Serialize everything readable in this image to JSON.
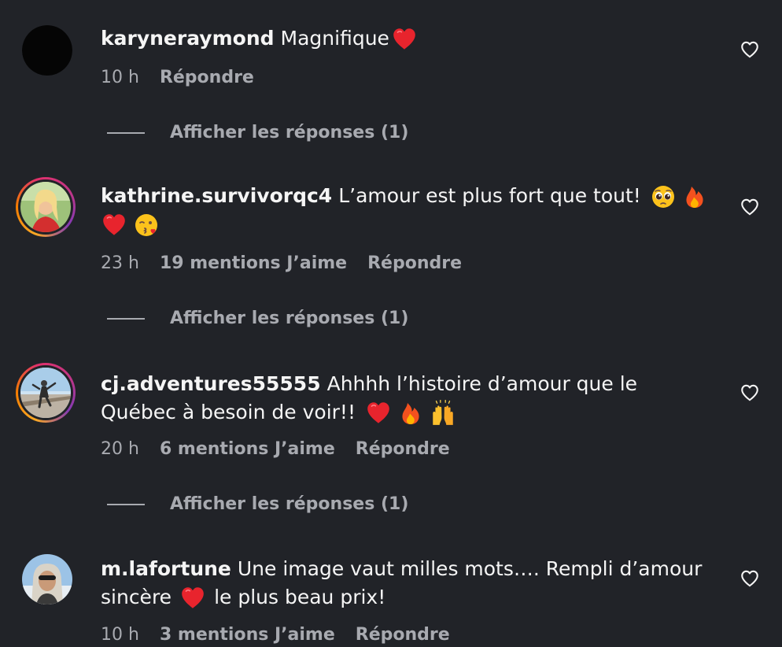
{
  "comments": [
    {
      "username": "karyneraymond",
      "text": "Magnifique",
      "time": "10 h",
      "likes": "",
      "reply_label": "Répondre",
      "show_replies": "Afficher les réponses (1)"
    },
    {
      "username": "kathrine.survivorqc4",
      "text": "L’amour est plus fort que tout!",
      "time": "23 h",
      "likes": "19 mentions J’aime",
      "reply_label": "Répondre",
      "show_replies": "Afficher les réponses (1)"
    },
    {
      "username": "cj.adventures55555",
      "text": "Ahhhh l’histoire d’amour que le Québec à besoin de voir!!",
      "time": "20 h",
      "likes": "6 mentions J’aime",
      "reply_label": "Répondre",
      "show_replies": "Afficher les réponses (1)"
    },
    {
      "username": "m.lafortune",
      "text_part1": "Une image vaut milles mots…. Rempli d’amour sincère",
      "text_part2": "le plus beau prix!",
      "time": "10 h",
      "likes": "3 mentions J’aime",
      "reply_label": "Répondre"
    }
  ],
  "icons": {
    "like": "heart-outline-icon",
    "emoji_heart": "red-heart-icon",
    "emoji_pleading": "pleading-face-icon",
    "emoji_fire": "fire-icon",
    "emoji_kiss": "face-blowing-kiss-icon",
    "emoji_raised_hands": "raising-hands-icon"
  },
  "colors": {
    "background": "#212328",
    "text_primary": "#f5f5f5",
    "text_secondary": "#a8aab0",
    "heart_red": "#e8242d"
  }
}
